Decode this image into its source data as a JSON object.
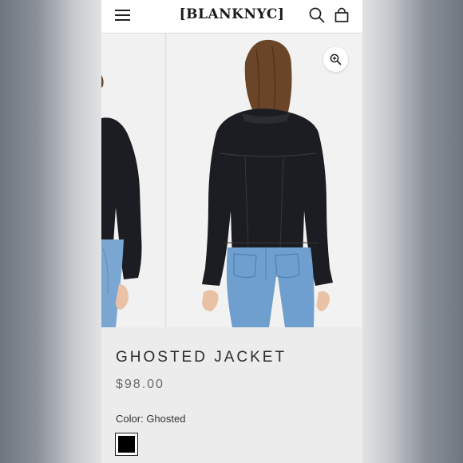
{
  "header": {
    "logo": "[BLANKNYC]",
    "menu_icon": "hamburger-menu-icon",
    "search_icon": "search-icon",
    "cart_icon": "shopping-bag-icon"
  },
  "gallery": {
    "zoom_icon": "zoom-in-icon"
  },
  "product": {
    "title": "GHOSTED JACKET",
    "price": "$98.00",
    "color_label": "Color:",
    "color_value": "Ghosted",
    "swatch_color": "#000000"
  },
  "colors": {
    "header_bg": "#ffffff",
    "page_bg": "#ececec",
    "jacket": "#1c1d21",
    "jeans": "#6f9fce",
    "hair": "#5a3a22"
  }
}
